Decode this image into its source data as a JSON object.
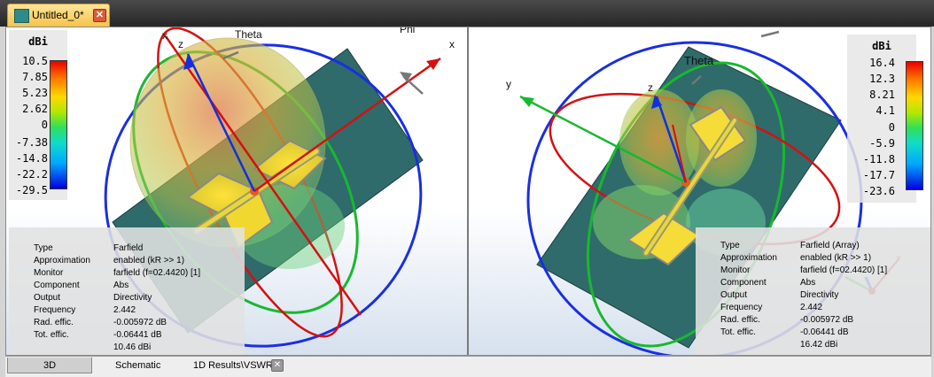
{
  "document_tab": {
    "title": "Untitled_0*",
    "close_glyph": "✕",
    "icon": "cst-project-icon"
  },
  "left_view": {
    "legend": {
      "unit": "dBi",
      "ticks": [
        "10.5",
        "7.85",
        "5.23",
        "2.62",
        "0",
        "-7.38",
        "-14.8",
        "-22.2",
        "-29.5"
      ]
    },
    "axis_labels": {
      "x": "x",
      "z": "z",
      "theta": "Theta",
      "phi": "Phi",
      "x2": "x"
    },
    "info": {
      "rows": [
        {
          "label": "Type",
          "value": "Farfield"
        },
        {
          "label": "Approximation",
          "value": "enabled (kR >> 1)"
        },
        {
          "label": "Monitor",
          "value": "farfield (f=02.4420) [1]"
        },
        {
          "label": "Component",
          "value": "Abs"
        },
        {
          "label": "Output",
          "value": "Directivity"
        },
        {
          "label": "Frequency",
          "value": "2.442"
        },
        {
          "label": "Rad. effic.",
          "value": "-0.005972 dB"
        },
        {
          "label": "Tot. effic.",
          "value": "-0.06441 dB"
        }
      ],
      "max_value": "10.46 dBi"
    }
  },
  "right_view": {
    "legend": {
      "unit": "dBi",
      "ticks": [
        "16.4",
        "12.3",
        "8.21",
        "4.1",
        "0",
        "-5.9",
        "-11.8",
        "-17.7",
        "-23.6"
      ]
    },
    "axis_labels": {
      "y": "y",
      "z": "z",
      "theta": "Theta"
    },
    "info": {
      "rows": [
        {
          "label": "Type",
          "value": "Farfield (Array)"
        },
        {
          "label": "Approximation",
          "value": "enabled (kR >> 1)"
        },
        {
          "label": "Monitor",
          "value": "farfield (f=02.4420) [1]"
        },
        {
          "label": "Component",
          "value": "Abs"
        },
        {
          "label": "Output",
          "value": "Directivity"
        },
        {
          "label": "Frequency",
          "value": "2.442"
        },
        {
          "label": "Rad. effic.",
          "value": "-0.005972 dB"
        },
        {
          "label": "Tot. effic.",
          "value": "-0.06441 dB"
        }
      ],
      "max_value": "16.42 dBi"
    }
  },
  "bottom_tabs": {
    "tab_3d": "3D",
    "tab_schematic": "Schematic",
    "tab_results": "1D Results\\VSWR",
    "close_glyph": "✕"
  },
  "colors": {
    "substrate": "#2f6b6a",
    "x_axis": "#e00000",
    "y_axis": "#00b000",
    "z_axis": "#0030e0",
    "tab_active": "#f7c24b"
  }
}
